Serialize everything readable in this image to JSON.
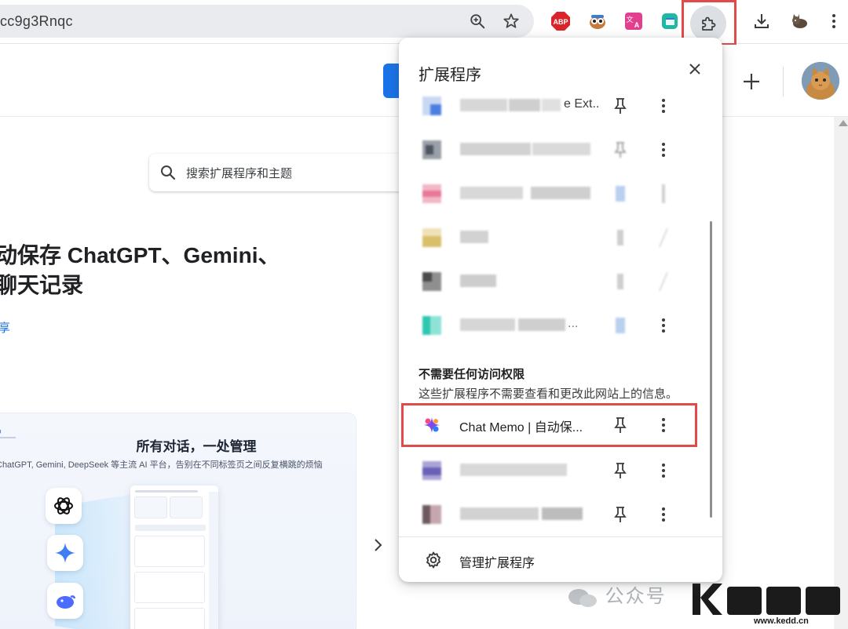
{
  "browser": {
    "url_fragment": "cc9g3Rnqc"
  },
  "store": {
    "search_placeholder": "搜索扩展程序和主题",
    "title_line1": "动保存 ChatGPT、Gemini、",
    "title_line2": "‌聊天记录",
    "link_text": "享",
    "promo": {
      "title": "所有对话，一处管理",
      "subtitle": "ChatGPT, Gemini, DeepSeek 等主流 AI 平台，告别在不同标签页之间反复横跳的烦恼"
    }
  },
  "popup": {
    "title": "扩展程序",
    "partial_name_1": "e Ext..",
    "partial_name_6": "...",
    "section_heading": "不需要任何访问权限",
    "section_desc": "这些扩展程序不需要查看和更改此网站上的信息。",
    "highlighted_extension": "Chat Memo | 自动保...",
    "manage_label": "管理扩展程序"
  },
  "watermark": {
    "text": "公众号",
    "url": "www.kedd.cn"
  },
  "colors": {
    "highlight": "#e24a4a",
    "accent": "#1a73e8",
    "toolbar_active": "#dcdfe3"
  }
}
